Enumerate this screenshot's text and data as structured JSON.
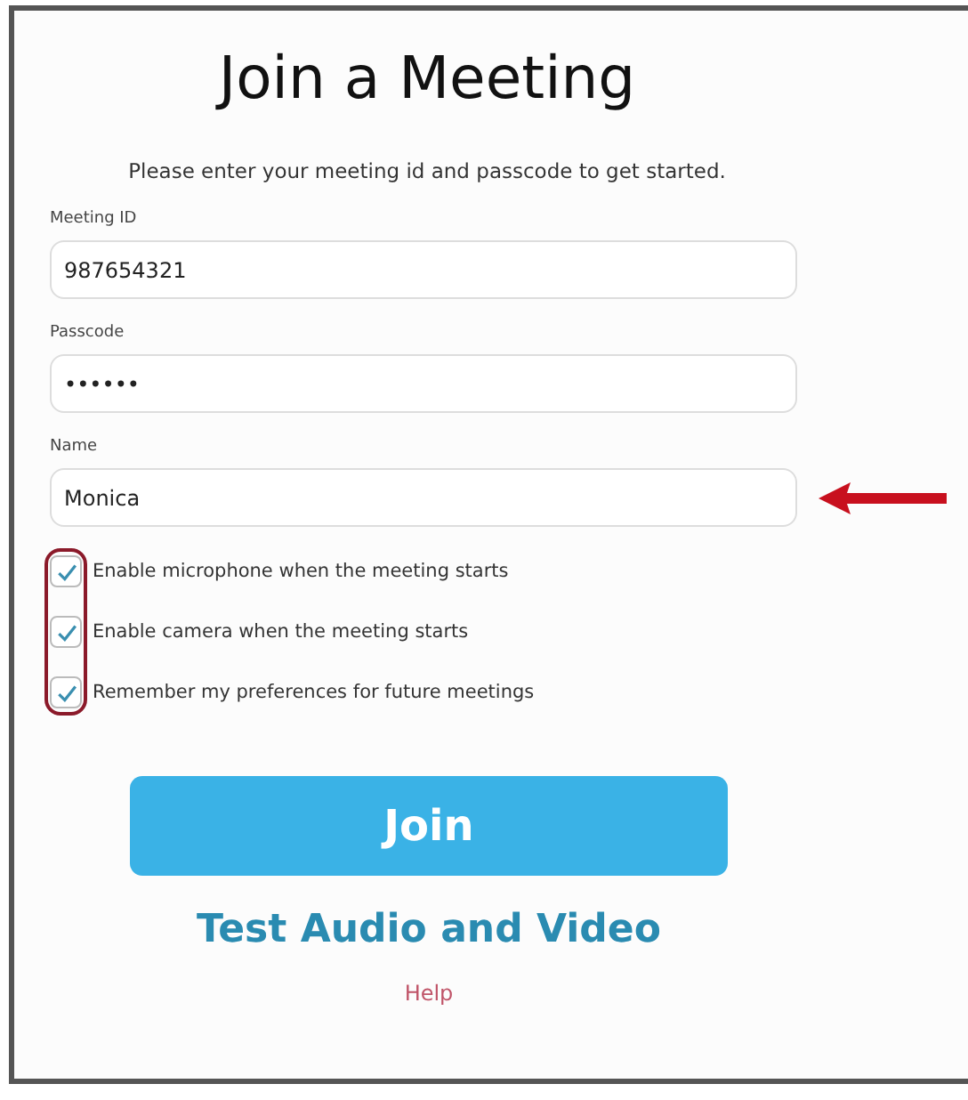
{
  "title": "Join a Meeting",
  "subtitle": "Please enter your meeting id and passcode to get started.",
  "fields": [
    {
      "label": "Meeting ID",
      "value": "987654321"
    },
    {
      "label": "Passcode",
      "value": "••••••"
    },
    {
      "label": "Name",
      "value": "Monica"
    }
  ],
  "options": [
    {
      "label": "Enable microphone when the meeting starts",
      "checked": true
    },
    {
      "label": "Enable camera when the meeting starts",
      "checked": true
    },
    {
      "label": "Remember my preferences for future meetings",
      "checked": true
    }
  ],
  "join_button": "Join",
  "test_link": "Test Audio and Video",
  "help_link": "Help"
}
